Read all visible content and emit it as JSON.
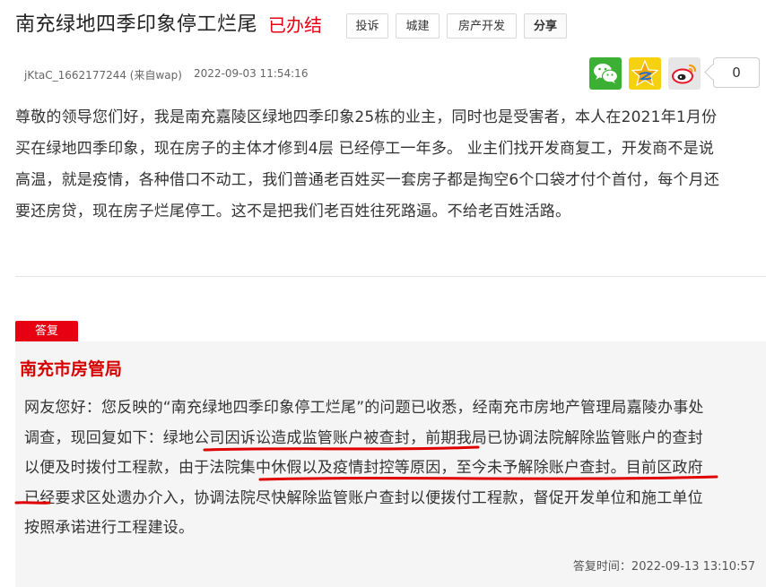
{
  "header": {
    "title": "南充绿地四季印象停工烂尾",
    "status": "已办结",
    "tags": [
      "投诉",
      "城建",
      "房产开发"
    ],
    "share_label": "分享"
  },
  "meta": {
    "author": "jKtaC_1662177244 (来自wap)",
    "time": "2022-09-03 11:54:16"
  },
  "share": {
    "icons": [
      "wechat-icon",
      "qzone-star-icon",
      "weibo-icon"
    ],
    "count": "0"
  },
  "content": {
    "text": "尊敬的领导您们好，我是南充嘉陵区绿地四季印象25栋的业主，同时也是受害者，本人在2021年1月份买在绿地四季印象，现在房子的主体才修到4层  已经停工一年多。 业主们找开发商复工，开发商不是说高温，就是疫情，各种借口不动工，我们普通老百姓买一套房子都是掏空6个口袋才付个首付，每个月还要还房贷，现在房子烂尾停工。这不是把我们老百姓往死路逼。不给老百姓活路。"
  },
  "reply": {
    "badge": "答复",
    "org": "南充市房管局",
    "text": "网友您好：您反映的“南充绿地四季印象停工烂尾”的问题已收悉，经南充市房地产管理局嘉陵办事处调查，现回复如下：绿地公司因诉讼造成监管账户被查封，前期我局已协调法院解除监管账户的查封以便及时拨付工程款，由于法院集中休假以及疫情封控等原因，至今未予解除账户查封。目前区政府已经要求区处遗办介入，协调法院尽快解除监管账户查封以便拨付工程款，督促开发单位和施工单位按照承诺进行工程建设。",
    "time": "答复时间：2022-09-13 13:10:57"
  },
  "colors": {
    "accent_red": "#e60012",
    "org_red": "#d60000",
    "reply_bg": "#f5f5f5",
    "wechat_green": "#3cb034",
    "qzone_yellow": "#f6d10f",
    "underline_red": "#e00000"
  }
}
